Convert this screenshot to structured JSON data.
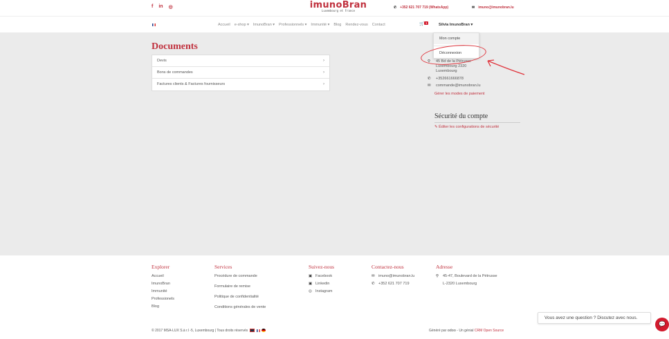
{
  "topbar": {
    "social_facebook": "f",
    "social_linkedin": "in",
    "social_instagram": "◎",
    "brand": "imunoBran",
    "brand_sub": "Luxembourg et France",
    "phone": "+352 621 707 719 (WhatsApp)",
    "email": "imuno@imunobran.lu"
  },
  "nav": {
    "items": [
      "Accueil",
      "e-shop ▾",
      "ImunoBran ▾",
      "Professionnels ▾",
      "Immunité ▾",
      "Blog",
      "Rendez-vous",
      "Contact"
    ],
    "cart_count": "1",
    "user": "Silvia ImunoBran ▾"
  },
  "dropdown": {
    "my_account": "Mon compte",
    "logout": "Déconnexion"
  },
  "documents": {
    "title": "Documents",
    "rows": [
      "Devis",
      "Bons de commandes",
      "Factures clients & Factures fournisseurs"
    ]
  },
  "account": {
    "address_line1": "45 Bd de la Pétrusse",
    "address_line2": "Luxembourg 2320",
    "address_line3": "Luxembourg",
    "phone": "+352661666878",
    "email": "commande@imunobran.lu",
    "payment_link": "Gérer les modes de paiement",
    "security_title": "Sécurité du compte",
    "security_link": "Éditer les configurations de sécurité"
  },
  "footer": {
    "explorer": {
      "title": "Explorer",
      "items": [
        "Accueil",
        "ImunoBran",
        "Immunité",
        "Professionels",
        "Blog"
      ]
    },
    "services": {
      "title": "Services",
      "items": [
        "Procédure de commande",
        "Formulaire de remise",
        "Politique de confidentialité",
        "Conditions générales de vente"
      ]
    },
    "follow": {
      "title": "Suivez-nous",
      "items": [
        "Facebook",
        "Linkedin",
        "Instagram"
      ]
    },
    "contact": {
      "title": "Contactez-nous",
      "email": "imuno@imunobran.lu",
      "phone": "+352 621 707 719"
    },
    "address": {
      "title": "Adresse",
      "line1": "45-47, Boulevard de la Pétrusse",
      "line2": "L-2320 Luxembourg"
    },
    "copyright": "© 2017 MSA-LUX S.à r.l -5, Luxembourg | Tous droits réservés",
    "generated_by": "Généré par",
    "odoo": "odoo",
    "crm_prefix": "- Un génial",
    "crm": "CRM Open Source"
  },
  "chat": {
    "prompt": "Vous avez une question ? Discutez avec nous."
  },
  "colors": {
    "accent": "#c0313e",
    "badge": "#d21b2e",
    "annotation": "#e0343c"
  }
}
